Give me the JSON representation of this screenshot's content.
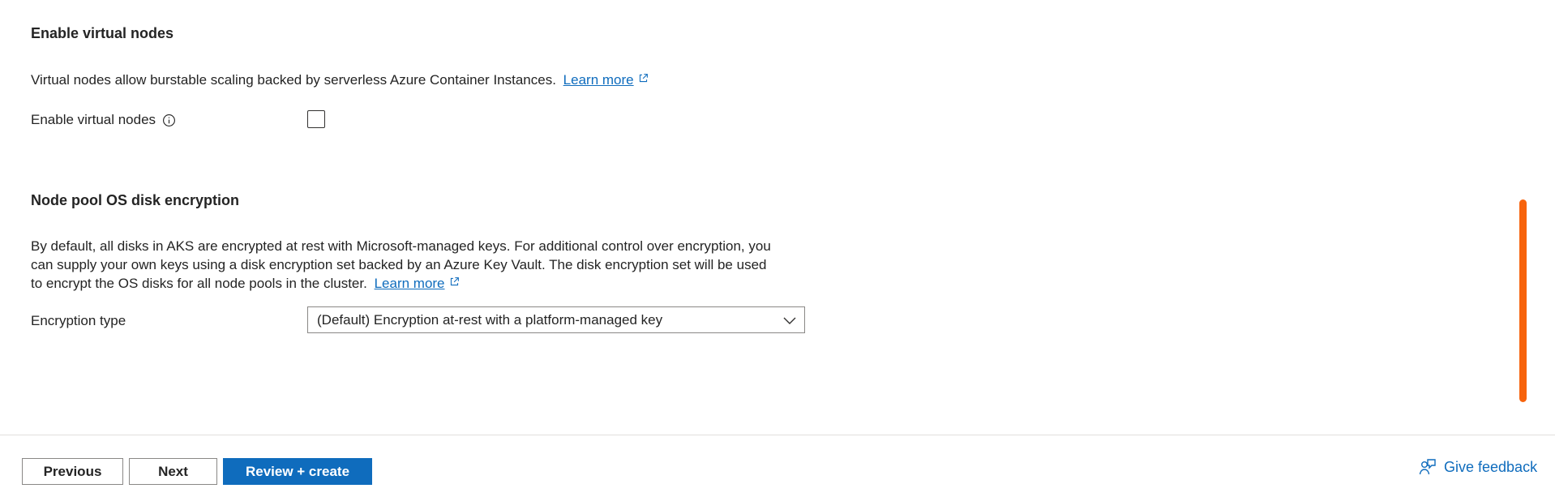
{
  "virtual_nodes": {
    "heading": "Enable virtual nodes",
    "description": "Virtual nodes allow burstable scaling backed by serverless Azure Container Instances.",
    "learn_more": "Learn more",
    "field_label": "Enable virtual nodes",
    "checked": false
  },
  "disk_encryption": {
    "heading": "Node pool OS disk encryption",
    "description_line1": "By default, all disks in AKS are encrypted at rest with Microsoft-managed keys. For additional control over encryption, you",
    "description_line2": "can supply your own keys using a disk encryption set backed by an Azure Key Vault. The disk encryption set will be used",
    "description_line3": "to encrypt the OS disks for all node pools in the cluster.",
    "learn_more": "Learn more",
    "field_label": "Encryption type",
    "selected_value": "(Default) Encryption at-rest with a platform-managed key"
  },
  "footer": {
    "previous_label": "Previous",
    "next_label": "Next",
    "review_create_label": "Review + create",
    "feedback_label": "Give feedback"
  },
  "colors": {
    "accent": "#0f6cbd",
    "scrollbar": "#f7630c",
    "text": "#242424"
  },
  "icons": {
    "external_link": "external-link-icon",
    "info": "info-icon",
    "chevron": "chevron-down-icon",
    "feedback": "feedback-icon"
  }
}
